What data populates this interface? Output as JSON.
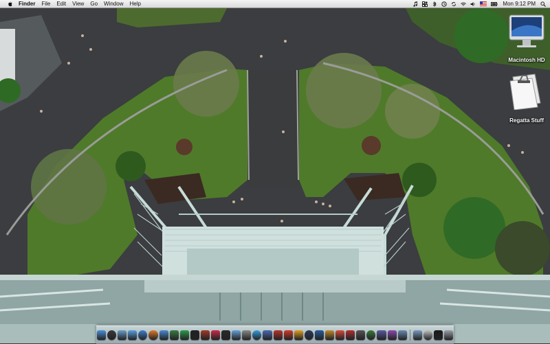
{
  "menubar": {
    "app_name": "Finder",
    "menus": [
      "File",
      "Edit",
      "View",
      "Go",
      "Window",
      "Help"
    ],
    "clock": "Mon 9:12 PM",
    "status_icons": [
      "itunes-note-icon",
      "spaces-icon",
      "bluetooth-icon",
      "time-machine-icon",
      "sync-icon",
      "wifi-icon",
      "volume-icon",
      "input-flag-icon",
      "battery-icon",
      "spotlight-icon"
    ]
  },
  "desktop": {
    "icons": [
      {
        "name": "macintosh-hd",
        "label": "Macintosh HD"
      },
      {
        "name": "regatta-stuff",
        "label": "Regatta Stuff"
      }
    ]
  },
  "dock": {
    "items": [
      {
        "name": "finder",
        "color": "#4a8fd8"
      },
      {
        "name": "dashboard",
        "color": "#3a3a3a"
      },
      {
        "name": "mail",
        "color": "#6a9ec8"
      },
      {
        "name": "ichat",
        "color": "#5aa0e0"
      },
      {
        "name": "safari",
        "color": "#3e7fd0"
      },
      {
        "name": "firefox",
        "color": "#e07a2a"
      },
      {
        "name": "itunes",
        "color": "#4a8acf"
      },
      {
        "name": "iphoto",
        "color": "#3a7c44"
      },
      {
        "name": "facetime",
        "color": "#2e9b4a"
      },
      {
        "name": "blackberry",
        "color": "#222222"
      },
      {
        "name": "address-book",
        "color": "#a33b2a"
      },
      {
        "name": "music",
        "color": "#cc2a4a"
      },
      {
        "name": "dvd-player",
        "color": "#2a2a2a"
      },
      {
        "name": "preview",
        "color": "#6aa0d8"
      },
      {
        "name": "system-prefs",
        "color": "#888888"
      },
      {
        "name": "skype",
        "color": "#33a0e0"
      },
      {
        "name": "adium",
        "color": "#4b6ab0"
      },
      {
        "name": "photo-booth",
        "color": "#b8342a"
      },
      {
        "name": "games",
        "color": "#d03a2a"
      },
      {
        "name": "stickies",
        "color": "#e0a020"
      },
      {
        "name": "quicktime",
        "color": "#2a3a5a"
      },
      {
        "name": "photoshop",
        "color": "#2a5a9a"
      },
      {
        "name": "garageband",
        "color": "#c08a2a"
      },
      {
        "name": "ical",
        "color": "#d84a3a"
      },
      {
        "name": "text-edit",
        "color": "#b03030"
      },
      {
        "name": "aperture",
        "color": "#555555"
      },
      {
        "name": "time-machine",
        "color": "#3a7a3a"
      },
      {
        "name": "itunes-2",
        "color": "#5a5aa0"
      },
      {
        "name": "applications",
        "color": "#8a4ab0"
      },
      {
        "name": "documents",
        "color": "#6a8ab0"
      },
      {
        "name": "downloads",
        "color": "#7a9ac0"
      },
      {
        "name": "magnifier",
        "color": "#c0c0c0"
      },
      {
        "name": "terminal",
        "color": "#1a1a1a"
      },
      {
        "name": "trash",
        "color": "#9aa0a6"
      }
    ]
  }
}
